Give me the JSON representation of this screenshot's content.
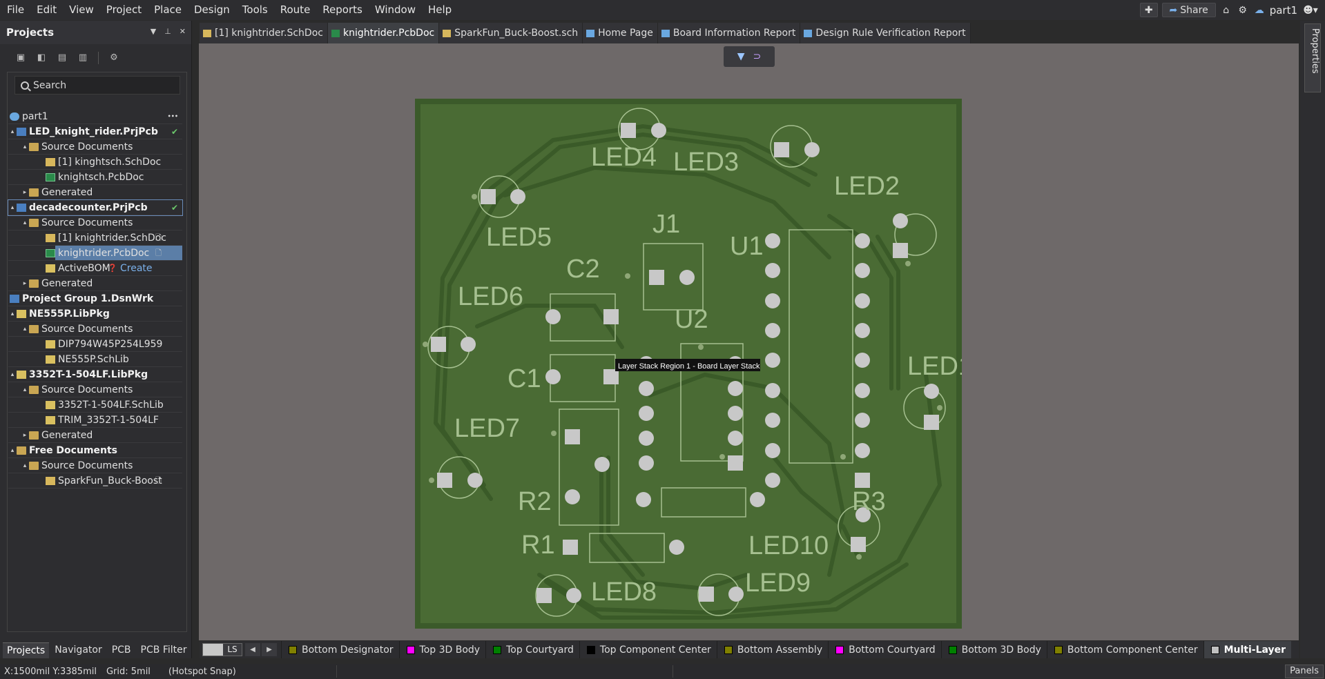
{
  "menubar": {
    "items": [
      "File",
      "Edit",
      "View",
      "Project",
      "Place",
      "Design",
      "Tools",
      "Route",
      "Reports",
      "Window",
      "Help"
    ],
    "share_label": "Share",
    "user_name": "part1"
  },
  "projects_panel": {
    "title": "Projects",
    "search_placeholder": "Search",
    "tree": [
      {
        "label": "part1",
        "indent": 0,
        "kind": "cloud",
        "bold": false,
        "dots": true
      },
      {
        "label": "LED_knight_rider.PrjPcb",
        "indent": 1,
        "kind": "prj",
        "bold": true,
        "arrow": "▴",
        "check": true
      },
      {
        "label": "Source Documents",
        "indent": 2,
        "kind": "folder",
        "arrow": "▴"
      },
      {
        "label": "[1] kinghtsch.SchDoc",
        "indent": 3,
        "kind": "sch"
      },
      {
        "label": "knightsch.PcbDoc",
        "indent": 3,
        "kind": "pcb"
      },
      {
        "label": "Generated",
        "indent": 2,
        "kind": "folder",
        "arrow": "▸"
      },
      {
        "label": "decadecounter.PrjPcb",
        "indent": 1,
        "kind": "prj",
        "bold": true,
        "arrow": "▴",
        "check": true,
        "outlined": true
      },
      {
        "label": "Source Documents",
        "indent": 2,
        "kind": "folder",
        "arrow": "▴"
      },
      {
        "label": "[1] knightrider.SchDoc",
        "indent": 3,
        "kind": "sch",
        "docmark": true
      },
      {
        "label": "knightrider.PcbDoc",
        "indent": 3,
        "kind": "pcb",
        "docmark": true,
        "selected": true
      },
      {
        "label": "ActiveBOM",
        "indent": 3,
        "kind": "lib",
        "extra": "Create"
      },
      {
        "label": "Generated",
        "indent": 2,
        "kind": "folder",
        "arrow": "▸"
      },
      {
        "label": "Project Group 1.DsnWrk",
        "indent": 0,
        "kind": "prj",
        "bold": true
      },
      {
        "label": "NE555P.LibPkg",
        "indent": 1,
        "kind": "lib",
        "bold": true,
        "arrow": "▴"
      },
      {
        "label": "Source Documents",
        "indent": 2,
        "kind": "folder",
        "arrow": "▴"
      },
      {
        "label": "DIP794W45P254L959",
        "indent": 3,
        "kind": "lib"
      },
      {
        "label": "NE555P.SchLib",
        "indent": 3,
        "kind": "lib"
      },
      {
        "label": "3352T-1-504LF.LibPkg",
        "indent": 1,
        "kind": "lib",
        "bold": true,
        "arrow": "▴"
      },
      {
        "label": "Source Documents",
        "indent": 2,
        "kind": "folder",
        "arrow": "▴"
      },
      {
        "label": "3352T-1-504LF.SchLib",
        "indent": 3,
        "kind": "lib"
      },
      {
        "label": "TRIM_3352T-1-504LF",
        "indent": 3,
        "kind": "lib"
      },
      {
        "label": "Generated",
        "indent": 2,
        "kind": "folder",
        "arrow": "▸"
      },
      {
        "label": "Free Documents",
        "indent": 1,
        "kind": "folder",
        "bold": true,
        "arrow": "▴"
      },
      {
        "label": "Source Documents",
        "indent": 2,
        "kind": "folder",
        "arrow": "▴"
      },
      {
        "label": "SparkFun_Buck-Boost",
        "indent": 3,
        "kind": "sch",
        "docmark": true
      }
    ],
    "bottom_tabs": [
      "Projects",
      "Navigator",
      "PCB",
      "PCB Filter"
    ]
  },
  "doc_tabs": [
    {
      "label": "[1] knightrider.SchDoc",
      "icon": "sch"
    },
    {
      "label": "knightrider.PcbDoc",
      "icon": "pcb",
      "active": true
    },
    {
      "label": "SparkFun_Buck-Boost.sch",
      "icon": "sch"
    },
    {
      "label": "Home Page",
      "icon": "home"
    },
    {
      "label": "Board Information Report",
      "icon": "report"
    },
    {
      "label": "Design Rule Verification Report",
      "icon": "report"
    }
  ],
  "board": {
    "tooltip": "Layer Stack Region 1 - Board Layer Stack",
    "designators": [
      "LED4",
      "LED3",
      "LED2",
      "LED5",
      "J1",
      "U1",
      "C2",
      "LED6",
      "U2",
      "LED1",
      "C1",
      "LED7",
      "R2",
      "R3",
      "R1",
      "LED10",
      "LED8",
      "LED9"
    ],
    "colors": {
      "board": "#4a6b34",
      "silk": "#a6c090",
      "pad": "#c8c8c8",
      "trace": "#3a5a28"
    }
  },
  "properties_label": "Properties",
  "layer_bar": {
    "ls_label": "LS",
    "layers": [
      {
        "name": "Bottom Designator",
        "color": "#808000"
      },
      {
        "name": "Top 3D Body",
        "color": "#ff00ff"
      },
      {
        "name": "Top Courtyard",
        "color": "#008000"
      },
      {
        "name": "Top Component Center",
        "color": "#000000"
      },
      {
        "name": "Bottom Assembly",
        "color": "#808000"
      },
      {
        "name": "Bottom Courtyard",
        "color": "#ff00ff"
      },
      {
        "name": "Bottom 3D Body",
        "color": "#008000"
      },
      {
        "name": "Bottom Component Center",
        "color": "#808000"
      },
      {
        "name": "Multi-Layer",
        "color": "#c0c0c0",
        "active": true
      }
    ]
  },
  "status": {
    "coords": "X:1500mil Y:3385mil",
    "grid": "Grid: 5mil",
    "snap": "(Hotspot Snap)",
    "panels_label": "Panels"
  }
}
